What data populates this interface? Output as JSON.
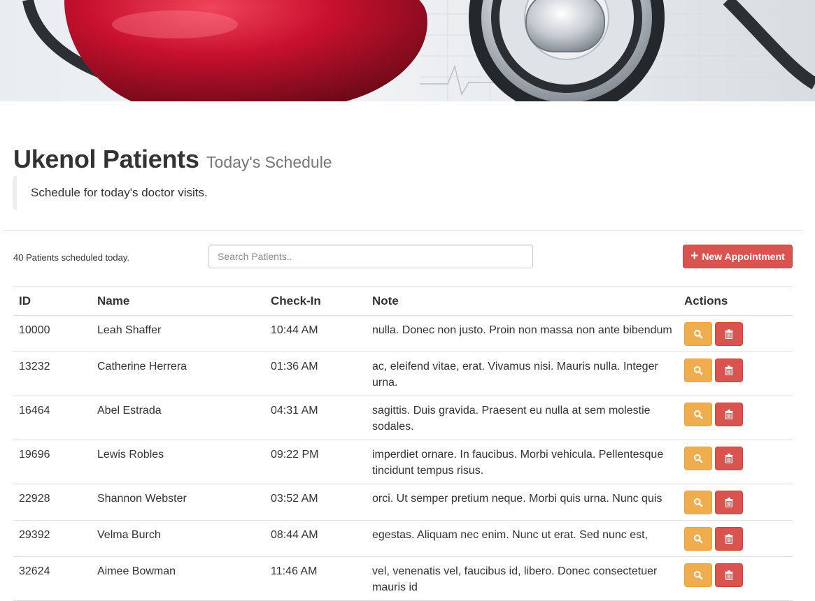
{
  "hero": {
    "image": "heart-and-stethoscope-banner"
  },
  "header": {
    "title": "Ukenol Patients",
    "subtitle": "Today's Schedule",
    "description": "Schedule for today's doctor visits."
  },
  "toolbar": {
    "count_text": "40 Patients scheduled today.",
    "search_placeholder": "Search Patients..",
    "search_value": "",
    "new_button_label": "New Appointment",
    "new_button_icon": "plus-icon"
  },
  "table": {
    "headers": {
      "id": "ID",
      "name": "Name",
      "checkin": "Check-In",
      "note": "Note",
      "actions": "Actions"
    },
    "rows": [
      {
        "id": "10000",
        "name": "Leah Shaffer",
        "checkin": "10:44 AM",
        "note": "nulla. Donec non justo. Proin non massa non ante bibendum"
      },
      {
        "id": "13232",
        "name": "Catherine Herrera",
        "checkin": "01:36 AM",
        "note": "ac, eleifend vitae, erat. Vivamus nisi. Mauris nulla. Integer urna."
      },
      {
        "id": "16464",
        "name": "Abel Estrada",
        "checkin": "04:31 AM",
        "note": "sagittis. Duis gravida. Praesent eu nulla at sem molestie sodales."
      },
      {
        "id": "19696",
        "name": "Lewis Robles",
        "checkin": "09:22 PM",
        "note": "imperdiet ornare. In faucibus. Morbi vehicula. Pellentesque tincidunt tempus risus."
      },
      {
        "id": "22928",
        "name": "Shannon Webster",
        "checkin": "03:52 AM",
        "note": "orci. Ut semper pretium neque. Morbi quis urna. Nunc quis"
      },
      {
        "id": "29392",
        "name": "Velma Burch",
        "checkin": "08:44 AM",
        "note": "egestas. Aliquam nec enim. Nunc ut erat. Sed nunc est,"
      },
      {
        "id": "32624",
        "name": "Aimee Bowman",
        "checkin": "11:46 AM",
        "note": "vel, venenatis vel, faucibus id, libero. Donec consectetuer mauris id"
      }
    ],
    "row_actions": {
      "view_icon": "search-icon",
      "delete_icon": "trash-icon"
    }
  },
  "colors": {
    "danger": "#d9534f",
    "warning": "#f0ad4e",
    "text": "#333333",
    "muted": "#777777"
  }
}
